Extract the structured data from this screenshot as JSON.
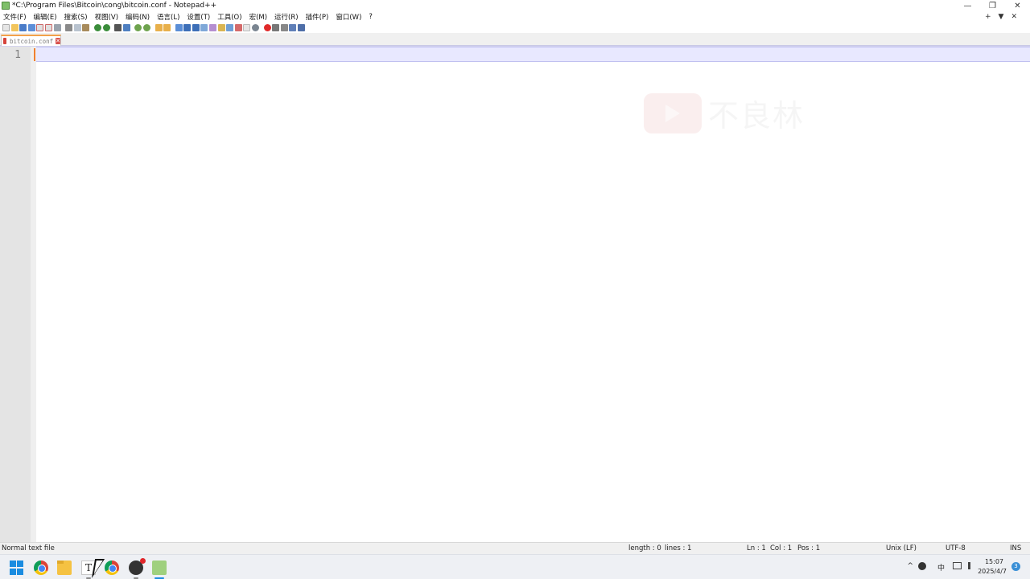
{
  "window": {
    "title": "*C:\\Program Files\\Bitcoin\\cong\\bitcoin.conf - Notepad++",
    "minimize": "—",
    "restore": "❐",
    "close": "✕"
  },
  "menu": {
    "items": [
      "文件(F)",
      "编辑(E)",
      "搜索(S)",
      "视图(V)",
      "编码(N)",
      "语言(L)",
      "设置(T)",
      "工具(O)",
      "宏(M)",
      "运行(R)",
      "插件(P)",
      "窗口(W)",
      "?"
    ],
    "right_plus": "+",
    "right_dropdown": "▼",
    "right_close": "✕"
  },
  "tab": {
    "label": "bitcoin.conf",
    "close": "✕"
  },
  "editor": {
    "line_number": "1",
    "watermark_text": "不良林"
  },
  "statusbar": {
    "file_type": "Normal text file",
    "length": "length : 0",
    "lines": "lines : 1",
    "ln": "Ln : 1",
    "col": "Col : 1",
    "pos": "Pos : 1",
    "eol": "Unix (LF)",
    "encoding": "UTF-8",
    "mode": "INS"
  },
  "taskbar": {
    "text_app_glyph": "T",
    "tray_chevron": "^",
    "ime": "中",
    "time": "15:07",
    "date": "2025/4/7",
    "notifications": "3"
  },
  "colors": {
    "current_line": "#e8e8ff",
    "caret": "#f08030",
    "tab_accent": "#f3a14a",
    "gutter": "#e4e4e4"
  },
  "toolbar_icons": [
    "new-file-icon",
    "open-file-icon",
    "save-icon",
    "save-all-icon",
    "close-icon",
    "close-all-icon",
    "print-icon",
    "cut-icon",
    "copy-icon",
    "paste-icon",
    "undo-icon",
    "redo-icon",
    "find-icon",
    "replace-icon",
    "zoom-in-icon",
    "zoom-out-icon",
    "sync-vertical-icon",
    "sync-horizontal-icon",
    "word-wrap-icon",
    "show-all-chars-icon",
    "indent-guide-icon",
    "document-map-icon",
    "function-list-icon",
    "folder-workspace-icon",
    "monitoring-icon",
    "record-macro-icon",
    "stop-macro-icon",
    "play-macro-icon",
    "run-macro-multiple-icon",
    "save-macro-icon"
  ]
}
